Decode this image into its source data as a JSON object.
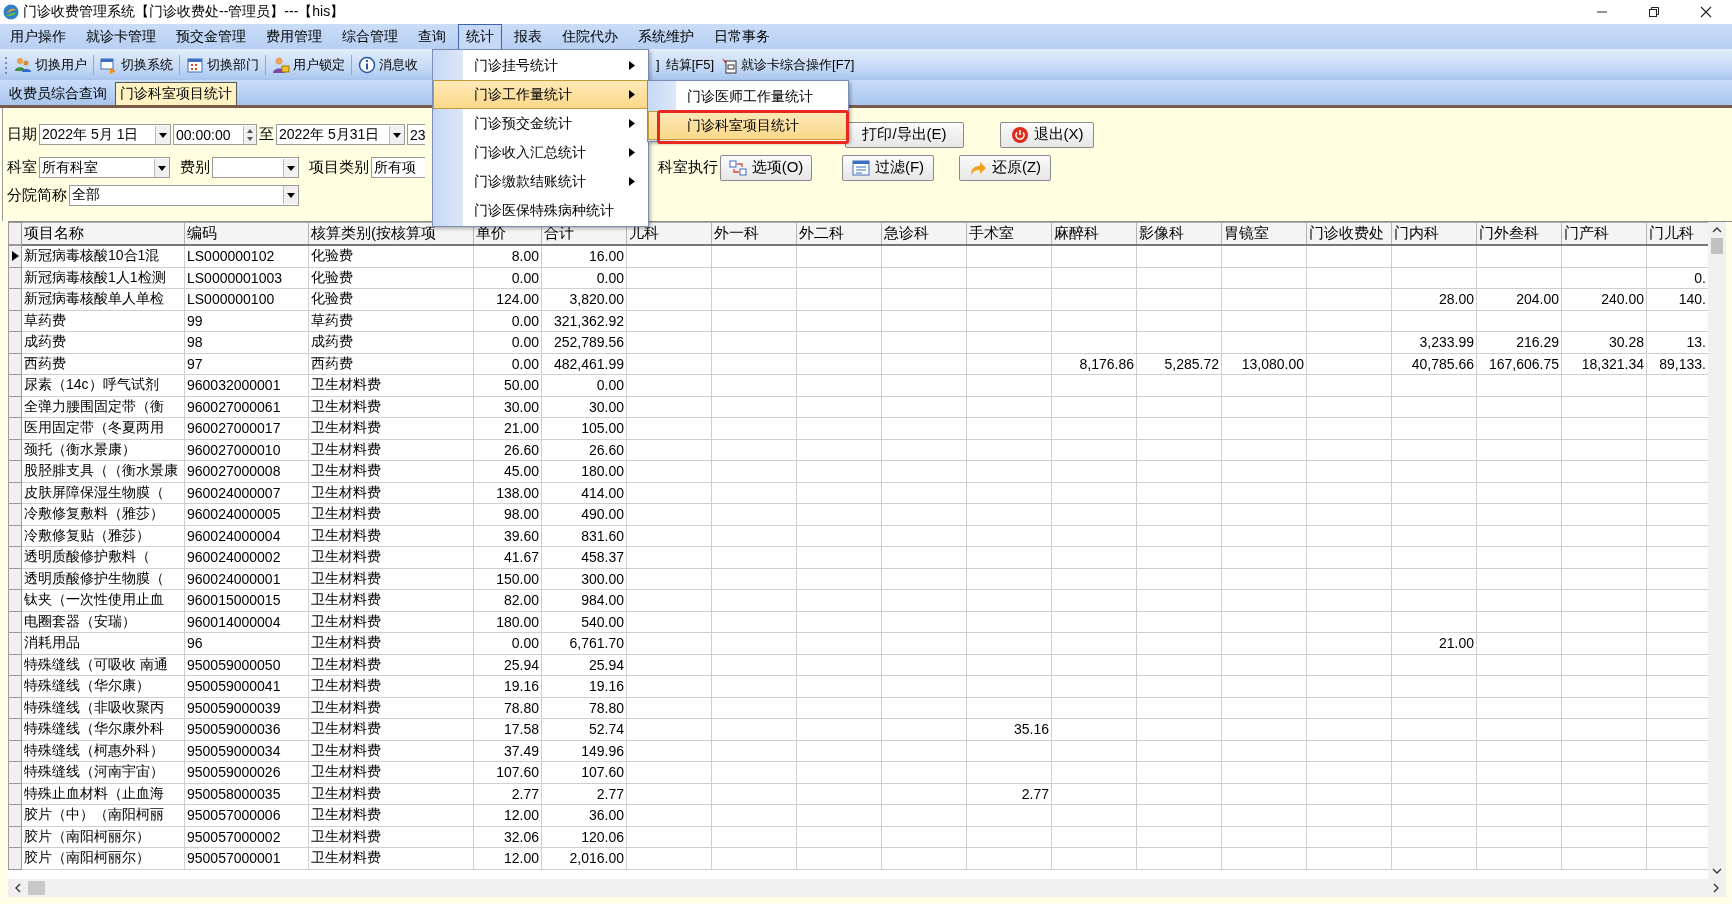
{
  "window": {
    "title": "门诊收费管理系统【门诊收费处--管理员】---【his】"
  },
  "menu_bar": [
    {
      "label": "用户操作",
      "selected": false
    },
    {
      "label": "就诊卡管理",
      "selected": false
    },
    {
      "label": "预交金管理",
      "selected": false
    },
    {
      "label": "费用管理",
      "selected": false
    },
    {
      "label": "综合管理",
      "selected": false
    },
    {
      "label": "查询",
      "selected": false
    },
    {
      "label": "统计",
      "selected": true
    },
    {
      "label": "报表",
      "selected": false
    },
    {
      "label": "住院代办",
      "selected": false
    },
    {
      "label": "系统维护",
      "selected": false
    },
    {
      "label": "日常事务",
      "selected": false
    }
  ],
  "toolbar_left": [
    "切换用户",
    "切换系统",
    "切换部门",
    "用户锁定",
    "消息收"
  ],
  "toolbar_right": [
    "]",
    "结算[F5]",
    "就诊卡综合操作[F7]"
  ],
  "tabs": [
    {
      "label": "收费员综合查询",
      "selected": false
    },
    {
      "label": "门诊科室项目统计",
      "selected": true
    }
  ],
  "filters": {
    "date_label": "日期",
    "date_from": "2022年 5月 1日",
    "time_from": "00:00:00",
    "to_label": "至",
    "date_to": "2022年 5月31日",
    "time_to": "23",
    "print_button": "打印/导出(E)",
    "exit_button": "退出(X)",
    "department_label": "科室",
    "department": "所有科室",
    "fee_type_label": "费别",
    "category_label": "项目类别",
    "category": "所有项",
    "dept_exec_label": "科室执行",
    "options_button": "选项(O)",
    "filter_button": "过滤(F)",
    "restore_button": "还原(Z)",
    "branch_label": "分院简称",
    "branch": "全部"
  },
  "stats_menu": [
    {
      "label": "门诊挂号统计",
      "has_submenu": true,
      "selected": false
    },
    {
      "label": "门诊工作量统计",
      "has_submenu": true,
      "selected": true
    },
    {
      "label": "门诊预交金统计",
      "has_submenu": true,
      "selected": false
    },
    {
      "label": "门诊收入汇总统计",
      "has_submenu": true,
      "selected": false
    },
    {
      "label": "门诊缴款结账统计",
      "has_submenu": true,
      "selected": false
    },
    {
      "label": "门诊医保特殊病种统计",
      "has_submenu": false,
      "selected": false
    }
  ],
  "submenu": [
    {
      "label": "门诊医师工作量统计",
      "selected": false,
      "outlined": false
    },
    {
      "label": "门诊科室项目统计",
      "selected": true,
      "outlined": true
    }
  ],
  "table": {
    "columns": [
      "项目名称",
      "编码",
      "核算类别(按核算项",
      "单价",
      "合计"
    ],
    "dept_columns": [
      "儿科",
      "外一科",
      "外二科",
      "急诊科",
      "手术室",
      "麻醉科",
      "影像科",
      "胃镜室",
      "门诊收费处",
      "门内科",
      "门外叁科",
      "门产科",
      "门儿科"
    ],
    "rows": [
      {
        "selected": true,
        "name": "新冠病毒核酸10合1混",
        "code": "LS000000102",
        "category": "化验费",
        "price": "8.00",
        "total": "16.00",
        "cells": [
          null,
          null,
          null,
          null,
          null,
          null,
          null,
          null,
          null,
          null,
          null,
          null,
          null
        ]
      },
      {
        "selected": false,
        "name": "新冠病毒核酸1人1检测",
        "code": "LS0000001003",
        "category": "化验费",
        "price": "0.00",
        "total": "0.00",
        "cells": [
          null,
          null,
          null,
          null,
          null,
          null,
          null,
          null,
          null,
          null,
          null,
          null,
          "0."
        ]
      },
      {
        "selected": false,
        "name": "新冠病毒核酸单人单检",
        "code": "LS000000100",
        "category": "化验费",
        "price": "124.00",
        "total": "3,820.00",
        "cells": [
          null,
          null,
          null,
          null,
          null,
          null,
          null,
          null,
          null,
          "28.00",
          "204.00",
          "240.00",
          "140."
        ]
      },
      {
        "selected": false,
        "name": "草药费",
        "code": "99",
        "category": "草药费",
        "price": "0.00",
        "total": "321,362.92",
        "cells": [
          null,
          null,
          null,
          null,
          null,
          null,
          null,
          null,
          null,
          null,
          null,
          null,
          null
        ]
      },
      {
        "selected": false,
        "name": "成药费",
        "code": "98",
        "category": "成药费",
        "price": "0.00",
        "total": "252,789.56",
        "cells": [
          null,
          null,
          null,
          null,
          null,
          null,
          null,
          null,
          null,
          "3,233.99",
          "216.29",
          "30.28",
          "13."
        ]
      },
      {
        "selected": false,
        "name": "西药费",
        "code": "97",
        "category": "西药费",
        "price": "0.00",
        "total": "482,461.99",
        "cells": [
          null,
          null,
          null,
          null,
          null,
          "8,176.86",
          "5,285.72",
          "13,080.00",
          null,
          "40,785.66",
          "167,606.75",
          "18,321.34",
          "89,133."
        ]
      },
      {
        "selected": false,
        "name": "尿素（14c）呼气试剂",
        "code": "960032000001",
        "category": "卫生材料费",
        "price": "50.00",
        "total": "0.00",
        "cells": [
          null,
          null,
          null,
          null,
          null,
          null,
          null,
          null,
          null,
          null,
          null,
          null,
          null
        ]
      },
      {
        "selected": false,
        "name": "全弹力腰围固定带（衡",
        "code": "960027000061",
        "category": "卫生材料费",
        "price": "30.00",
        "total": "30.00",
        "cells": [
          null,
          null,
          null,
          null,
          null,
          null,
          null,
          null,
          null,
          null,
          null,
          null,
          null
        ]
      },
      {
        "selected": false,
        "name": "医用固定带（冬夏两用",
        "code": "960027000017",
        "category": "卫生材料费",
        "price": "21.00",
        "total": "105.00",
        "cells": [
          null,
          null,
          null,
          null,
          null,
          null,
          null,
          null,
          null,
          null,
          null,
          null,
          null
        ]
      },
      {
        "selected": false,
        "name": "颈托（衡水景康）",
        "code": "960027000010",
        "category": "卫生材料费",
        "price": "26.60",
        "total": "26.60",
        "cells": [
          null,
          null,
          null,
          null,
          null,
          null,
          null,
          null,
          null,
          null,
          null,
          null,
          null
        ]
      },
      {
        "selected": false,
        "name": "股胫腓支具（（衡水景康",
        "code": "960027000008",
        "category": "卫生材料费",
        "price": "45.00",
        "total": "180.00",
        "cells": [
          null,
          null,
          null,
          null,
          null,
          null,
          null,
          null,
          null,
          null,
          null,
          null,
          null
        ]
      },
      {
        "selected": false,
        "name": "皮肤屏障保湿生物膜（",
        "code": "960024000007",
        "category": "卫生材料费",
        "price": "138.00",
        "total": "414.00",
        "cells": [
          null,
          null,
          null,
          null,
          null,
          null,
          null,
          null,
          null,
          null,
          null,
          null,
          null
        ]
      },
      {
        "selected": false,
        "name": "冷敷修复敷料（雅莎）",
        "code": "960024000005",
        "category": "卫生材料费",
        "price": "98.00",
        "total": "490.00",
        "cells": [
          null,
          null,
          null,
          null,
          null,
          null,
          null,
          null,
          null,
          null,
          null,
          null,
          null
        ]
      },
      {
        "selected": false,
        "name": "冷敷修复贴（雅莎）",
        "code": "960024000004",
        "category": "卫生材料费",
        "price": "39.60",
        "total": "831.60",
        "cells": [
          null,
          null,
          null,
          null,
          null,
          null,
          null,
          null,
          null,
          null,
          null,
          null,
          null
        ]
      },
      {
        "selected": false,
        "name": "透明质酸修护敷料（",
        "code": "960024000002",
        "category": "卫生材料费",
        "price": "41.67",
        "total": "458.37",
        "cells": [
          null,
          null,
          null,
          null,
          null,
          null,
          null,
          null,
          null,
          null,
          null,
          null,
          null
        ]
      },
      {
        "selected": false,
        "name": "透明质酸修护生物膜（",
        "code": "960024000001",
        "category": "卫生材料费",
        "price": "150.00",
        "total": "300.00",
        "cells": [
          null,
          null,
          null,
          null,
          null,
          null,
          null,
          null,
          null,
          null,
          null,
          null,
          null
        ]
      },
      {
        "selected": false,
        "name": "钛夹（一次性使用止血",
        "code": "960015000015",
        "category": "卫生材料费",
        "price": "82.00",
        "total": "984.00",
        "cells": [
          null,
          null,
          null,
          null,
          null,
          null,
          null,
          null,
          null,
          null,
          null,
          null,
          null
        ]
      },
      {
        "selected": false,
        "name": "电圈套器（安瑞）",
        "code": "960014000004",
        "category": "卫生材料费",
        "price": "180.00",
        "total": "540.00",
        "cells": [
          null,
          null,
          null,
          null,
          null,
          null,
          null,
          null,
          null,
          null,
          null,
          null,
          null
        ]
      },
      {
        "selected": false,
        "name": "消耗用品",
        "code": "96",
        "category": "卫生材料费",
        "price": "0.00",
        "total": "6,761.70",
        "cells": [
          null,
          null,
          null,
          null,
          null,
          null,
          null,
          null,
          null,
          "21.00",
          null,
          null,
          null
        ]
      },
      {
        "selected": false,
        "name": "特殊缝线（可吸收 南通",
        "code": "950059000050",
        "category": "卫生材料费",
        "price": "25.94",
        "total": "25.94",
        "cells": [
          null,
          null,
          null,
          null,
          null,
          null,
          null,
          null,
          null,
          null,
          null,
          null,
          null
        ]
      },
      {
        "selected": false,
        "name": "特殊缝线（华尔康）",
        "code": "950059000041",
        "category": "卫生材料费",
        "price": "19.16",
        "total": "19.16",
        "cells": [
          null,
          null,
          null,
          null,
          null,
          null,
          null,
          null,
          null,
          null,
          null,
          null,
          null
        ]
      },
      {
        "selected": false,
        "name": "特殊缝线（非吸收聚丙",
        "code": "950059000039",
        "category": "卫生材料费",
        "price": "78.80",
        "total": "78.80",
        "cells": [
          null,
          null,
          null,
          null,
          null,
          null,
          null,
          null,
          null,
          null,
          null,
          null,
          null
        ]
      },
      {
        "selected": false,
        "name": "特殊缝线（华尔康外科",
        "code": "950059000036",
        "category": "卫生材料费",
        "price": "17.58",
        "total": "52.74",
        "cells": [
          null,
          null,
          null,
          null,
          "35.16",
          null,
          null,
          null,
          null,
          null,
          null,
          null,
          null
        ]
      },
      {
        "selected": false,
        "name": "特殊缝线（柯惠外科）",
        "code": "950059000034",
        "category": "卫生材料费",
        "price": "37.49",
        "total": "149.96",
        "cells": [
          null,
          null,
          null,
          null,
          null,
          null,
          null,
          null,
          null,
          null,
          null,
          null,
          null
        ]
      },
      {
        "selected": false,
        "name": "特殊缝线（河南宇宙）",
        "code": "950059000026",
        "category": "卫生材料费",
        "price": "107.60",
        "total": "107.60",
        "cells": [
          null,
          null,
          null,
          null,
          null,
          null,
          null,
          null,
          null,
          null,
          null,
          null,
          null
        ]
      },
      {
        "selected": false,
        "name": "特殊止血材料（止血海",
        "code": "950058000035",
        "category": "卫生材料费",
        "price": "2.77",
        "total": "2.77",
        "cells": [
          null,
          null,
          null,
          null,
          "2.77",
          null,
          null,
          null,
          null,
          null,
          null,
          null,
          null
        ]
      },
      {
        "selected": false,
        "name": "胶片（中）（南阳柯丽",
        "code": "950057000006",
        "category": "卫生材料费",
        "price": "12.00",
        "total": "36.00",
        "cells": [
          null,
          null,
          null,
          null,
          null,
          null,
          null,
          null,
          null,
          null,
          null,
          null,
          null
        ]
      },
      {
        "selected": false,
        "name": "胶片（南阳柯丽尔）",
        "code": "950057000002",
        "category": "卫生材料费",
        "price": "32.06",
        "total": "120.06",
        "cells": [
          null,
          null,
          null,
          null,
          null,
          null,
          null,
          null,
          null,
          null,
          null,
          null,
          null
        ]
      },
      {
        "selected": false,
        "name": "胶片（南阳柯丽尔）",
        "code": "950057000001",
        "category": "卫生材料费",
        "price": "12.00",
        "total": "2,016.00",
        "cells": [
          null,
          null,
          null,
          null,
          null,
          null,
          null,
          null,
          null,
          null,
          null,
          null,
          null
        ]
      }
    ]
  }
}
